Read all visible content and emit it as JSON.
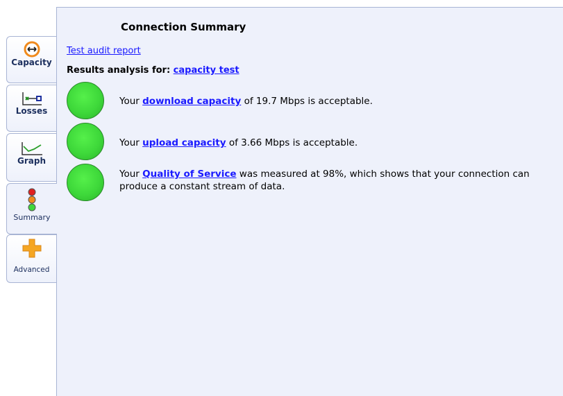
{
  "tabs": [
    {
      "label": "Capacity",
      "icon": "capacity-icon"
    },
    {
      "label": "Losses",
      "icon": "losses-icon"
    },
    {
      "label": "Graph",
      "icon": "graph-icon"
    },
    {
      "label": "Summary",
      "icon": "traffic-light-icon"
    },
    {
      "label": "Advanced",
      "icon": "plus-icon"
    }
  ],
  "main": {
    "title": "Connection Summary",
    "audit_link": "Test audit report",
    "results_prefix": "Results analysis for:",
    "results_link": "capacity test",
    "items": [
      {
        "status": "green",
        "pre": "Your ",
        "link": "download capacity",
        "post": " of 19.7 Mbps is acceptable."
      },
      {
        "status": "green",
        "pre": "Your ",
        "link": "upload capacity",
        "post": " of 3.66 Mbps is acceptable."
      },
      {
        "status": "green",
        "pre": "Your ",
        "link": "Quality of Service",
        "post": " was measured at 98%, which shows that your connection can produce a constant stream of data."
      }
    ]
  },
  "colors": {
    "status_green": "#3ed83a",
    "link": "#1a1aff",
    "panel": "#eef1fb"
  }
}
